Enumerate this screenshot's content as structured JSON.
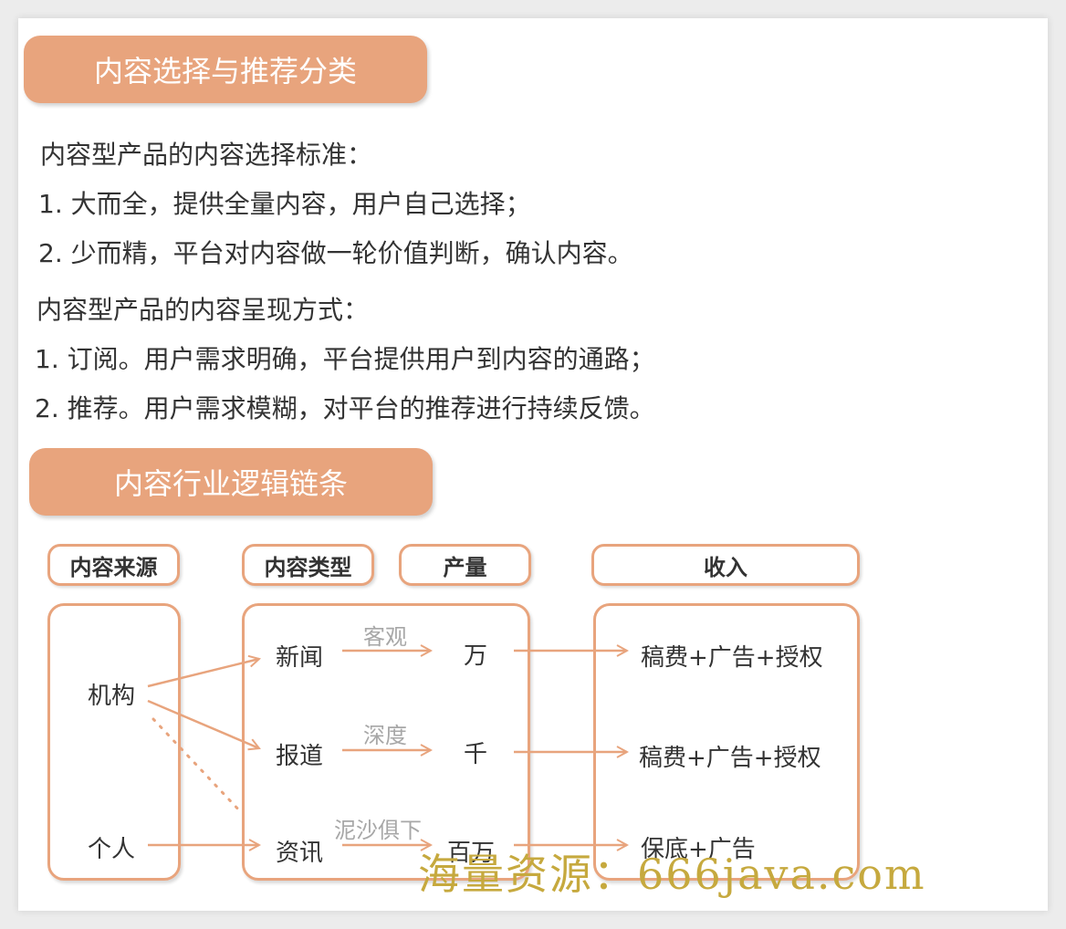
{
  "headers": {
    "section1": "内容选择与推荐分类",
    "section2": "内容行业逻辑链条"
  },
  "paragraphs": {
    "p1": "内容型产品的内容选择标准：",
    "p2": "1. 大而全，提供全量内容，用户自己选择；",
    "p3": "2. 少而精，平台对内容做一轮价值判断，确认内容。",
    "p4": "内容型产品的内容呈现方式：",
    "p5": "1. 订阅。用户需求明确，平台提供用户到内容的通路；",
    "p6": "2. 推荐。用户需求模糊，对平台的推荐进行持续反馈。"
  },
  "diagram": {
    "columns": {
      "source": "内容来源",
      "type": "内容类型",
      "output": "产量",
      "income": "收入"
    },
    "sources": {
      "org": "机构",
      "person": "个人"
    },
    "types": {
      "news": "新闻",
      "report": "报道",
      "info": "资讯"
    },
    "outputs": {
      "wan": "万",
      "qian": "千",
      "baiwan": "百万"
    },
    "edge_labels": {
      "objective": "客观",
      "depth": "深度",
      "mixed": "泥沙俱下"
    },
    "incomes": {
      "i1": "稿费+广告+授权",
      "i2": "稿费+广告+授权",
      "i3": "保底+广告"
    },
    "accent_color": "#e8a47d"
  },
  "watermark": "海量资源：666java.com"
}
